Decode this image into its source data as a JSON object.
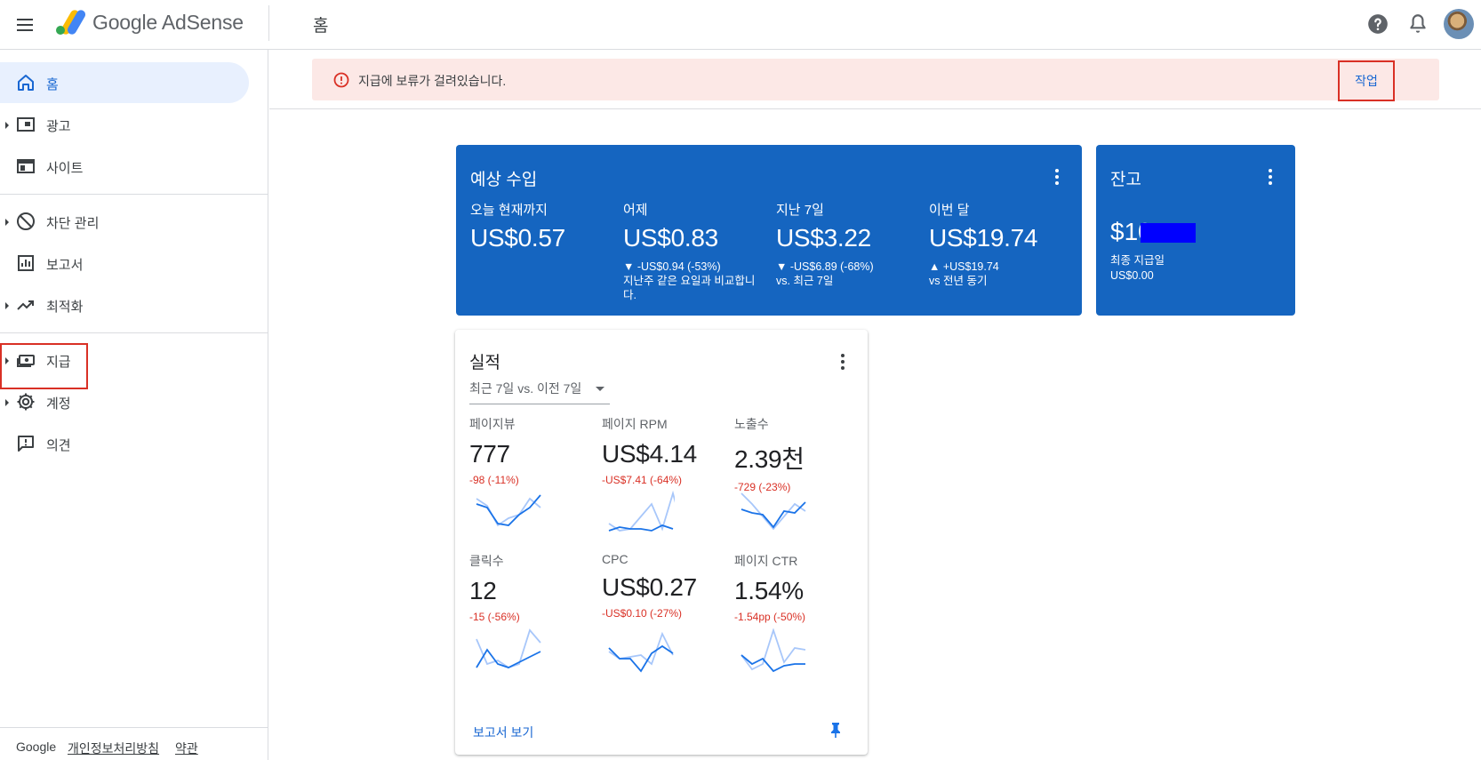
{
  "app": {
    "brand": "Google AdSense",
    "page_title": "홈"
  },
  "sidebar": {
    "items": [
      {
        "label": "홈",
        "icon": "home-icon",
        "active": true
      },
      {
        "label": "광고",
        "icon": "ads-icon"
      },
      {
        "label": "사이트",
        "icon": "sites-icon"
      },
      {
        "label": "차단 관리",
        "icon": "block-icon"
      },
      {
        "label": "보고서",
        "icon": "reports-icon"
      },
      {
        "label": "최적화",
        "icon": "trending-icon"
      },
      {
        "label": "지급",
        "icon": "payments-icon"
      },
      {
        "label": "계정",
        "icon": "gear-icon"
      },
      {
        "label": "의견",
        "icon": "feedback-icon"
      }
    ],
    "footer": {
      "google": "Google",
      "privacy": "개인정보처리방침",
      "terms": "약관"
    }
  },
  "alert": {
    "text": "지급에 보류가 걸려있습니다.",
    "action": "작업",
    "color": "#fce8e6"
  },
  "earnings": {
    "title": "예상 수입",
    "color": "#1565c0",
    "metrics": [
      {
        "label": "오늘 현재까지",
        "value": "US$0.57",
        "change": "",
        "note": ""
      },
      {
        "label": "어제",
        "value": "US$0.83",
        "change": "▼ -US$0.94 (-53%)",
        "note": "지난주 같은 요일과 비교합니다."
      },
      {
        "label": "지난 7일",
        "value": "US$3.22",
        "change": "▼ -US$6.89 (-68%)",
        "note": "vs. 최근 7일"
      },
      {
        "label": "이번 달",
        "value": "US$19.74",
        "change": "▲ +US$19.74",
        "note": "vs 전년 동기"
      }
    ]
  },
  "balance": {
    "title": "잔고",
    "value": "$10",
    "last_payment_label": "최종 지급일",
    "last_payment_value": "US$0.00"
  },
  "performance": {
    "title": "실적",
    "range": "최근 7일 vs. 이전 7일",
    "report_link": "보고서 보기",
    "metrics": [
      {
        "label": "페이지뷰",
        "value": "777",
        "change": "-98 (-11%)"
      },
      {
        "label": "페이지 RPM",
        "value": "US$4.14",
        "change": "-US$7.41 (-64%)"
      },
      {
        "label": "노출수",
        "value": "2.39천",
        "change": "-729 (-23%)"
      },
      {
        "label": "클릭수",
        "value": "12",
        "change": "-15 (-56%)"
      },
      {
        "label": "CPC",
        "value": "US$0.27",
        "change": "-US$0.10 (-27%)"
      },
      {
        "label": "페이지 CTR",
        "value": "1.54%",
        "change": "-1.54pp (-50%)"
      }
    ],
    "colors": {
      "current": "#1a73e8",
      "previous": "#a8c7fa",
      "negative": "#d93025"
    }
  }
}
